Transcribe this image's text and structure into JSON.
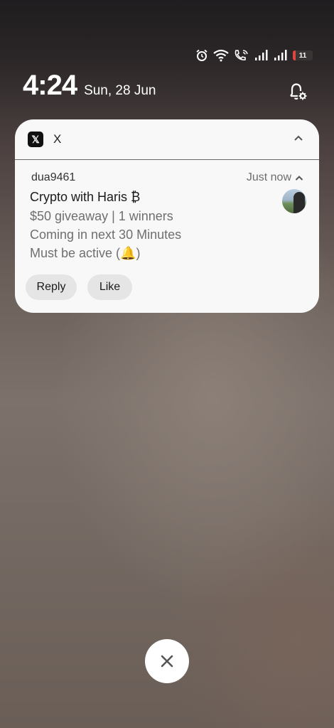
{
  "status_bar": {
    "battery_level": "11",
    "icons": [
      "alarm-icon",
      "wifi-icon",
      "wifi-calling-icon",
      "signal-icon",
      "signal-icon",
      "battery-icon"
    ]
  },
  "lockscreen": {
    "time": "4:24",
    "date": "Sun, 28 Jun"
  },
  "notification": {
    "app_icon_glyph": "𝕏",
    "app_name": "X",
    "sender": "dua9461",
    "timestamp": "Just now",
    "title": "Crypto with Haris ₿",
    "lines": [
      "$50 giveaway | 1 winners",
      "Coming in next 30 Minutes",
      "Must be active (🔔)"
    ],
    "actions": {
      "reply": "Reply",
      "like": "Like"
    }
  },
  "colors": {
    "card_bg": "#f8f8f8",
    "battery_low": "#e0453f",
    "action_bg": "#e5e5e5"
  }
}
